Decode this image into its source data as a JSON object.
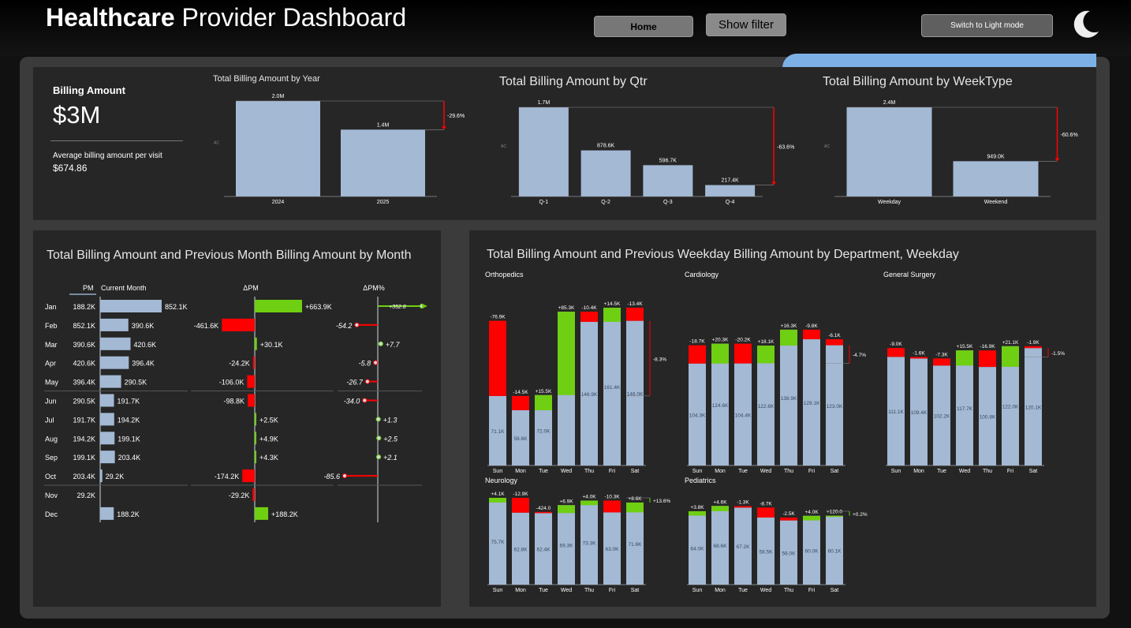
{
  "header": {
    "title_bold": "Healthcare",
    "title_rest": "Provider Dashboard",
    "home_label": "Home",
    "filter_label": "Show filter",
    "light_mode_label": "Switch to Light mode"
  },
  "kpi": {
    "label": "Billing Amount",
    "value": "$3M",
    "sub_label": "Average billing amount per visit",
    "sub_value": "$674.86"
  },
  "colors": {
    "bar": "#a3b9d4",
    "pos": "#6fcf12",
    "neg": "#ff0000"
  },
  "year_chart": {
    "title": "Total Billing Amount by Year",
    "axis_label": "AC",
    "categories": [
      "2024",
      "2025"
    ],
    "values": [
      2.0,
      1.4
    ],
    "labels": [
      "2.0M",
      "1.4M"
    ],
    "variance": "-29.6%"
  },
  "qtr_chart": {
    "title": "Total Billing Amount by Qtr",
    "axis_label": "AC",
    "categories": [
      "Q-1",
      "Q-2",
      "Q-3",
      "Q-4"
    ],
    "values": [
      1.7,
      0.8786,
      0.5967,
      0.2174
    ],
    "labels": [
      "1.7M",
      "878.6K",
      "596.7K",
      "217.4K"
    ],
    "variance": "-63.6%"
  },
  "week_chart": {
    "title": "Total Billing Amount by WeekType",
    "axis_label": "AC",
    "categories": [
      "Weekday",
      "Weekend"
    ],
    "values": [
      2.4,
      0.949
    ],
    "labels": [
      "2.4M",
      "949.0K"
    ],
    "variance": "-60.6%"
  },
  "month_table": {
    "title": "Total Billing Amount and Previous Month Billing Amount by Month",
    "headers": {
      "pm": "PM",
      "cm": "Current Month",
      "dpm": "ΔPM",
      "dpmp": "ΔPM%"
    },
    "rows": [
      {
        "month": "Jan",
        "pm": "188.2K",
        "cm": "852.1K",
        "cmv": 852.1,
        "d": "+663.9K",
        "dv": 663.9,
        "p": "+352.8",
        "pv": 352.8
      },
      {
        "month": "Feb",
        "pm": "852.1K",
        "cm": "390.6K",
        "cmv": 390.6,
        "d": "-461.6K",
        "dv": -461.6,
        "p": "-54.2",
        "pv": -54.2
      },
      {
        "month": "Mar",
        "pm": "390.6K",
        "cm": "420.6K",
        "cmv": 420.6,
        "d": "+30.1K",
        "dv": 30.1,
        "p": "+7.7",
        "pv": 7.7
      },
      {
        "month": "Apr",
        "pm": "420.6K",
        "cm": "396.4K",
        "cmv": 396.4,
        "d": "-24.2K",
        "dv": -24.2,
        "p": "-5.8",
        "pv": -5.8
      },
      {
        "month": "May",
        "pm": "396.4K",
        "cm": "290.5K",
        "cmv": 290.5,
        "d": "-106.0K",
        "dv": -106,
        "p": "-26.7",
        "pv": -26.7
      },
      {
        "month": "Jun",
        "pm": "290.5K",
        "cm": "191.7K",
        "cmv": 191.7,
        "d": "-98.8K",
        "dv": -98.8,
        "p": "-34.0",
        "pv": -34.0
      },
      {
        "month": "Jul",
        "pm": "191.7K",
        "cm": "194.2K",
        "cmv": 194.2,
        "d": "+2.5K",
        "dv": 2.5,
        "p": "+1.3",
        "pv": 1.3
      },
      {
        "month": "Aug",
        "pm": "194.2K",
        "cm": "199.1K",
        "cmv": 199.1,
        "d": "+4.9K",
        "dv": 4.9,
        "p": "+2.5",
        "pv": 2.5
      },
      {
        "month": "Sep",
        "pm": "199.1K",
        "cm": "203.4K",
        "cmv": 203.4,
        "d": "+4.3K",
        "dv": 4.3,
        "p": "+2.1",
        "pv": 2.1
      },
      {
        "month": "Oct",
        "pm": "203.4K",
        "cm": "29.2K",
        "cmv": 29.2,
        "d": "-174.2K",
        "dv": -174.2,
        "p": "-85.6",
        "pv": -85.6
      },
      {
        "month": "Nov",
        "pm": "29.2K",
        "cm": "",
        "cmv": 0,
        "d": "-29.2K",
        "dv": -29.2,
        "p": "",
        "pv": 0
      },
      {
        "month": "Dec",
        "pm": "",
        "cm": "188.2K",
        "cmv": 188.2,
        "d": "+188.2K",
        "dv": 188.2,
        "p": "",
        "pv": 0
      }
    ]
  },
  "dept_chart": {
    "title": "Total Billing Amount and Previous Weekday Billing Amount by Department, Weekday",
    "days": [
      "Sun",
      "Mon",
      "Tue",
      "Wed",
      "Thu",
      "Fri",
      "Sat"
    ],
    "departments": [
      {
        "name": "Orthopedics",
        "values": [
          71.1,
          56.6,
          72.0,
          157.3,
          146.9,
          161.4,
          148.0
        ],
        "value_labels": [
          "71.1K",
          "56.6K",
          "72.0K",
          "157.3K",
          "146.9K",
          "161.4K",
          "148.0K"
        ],
        "delta_labels": [
          "-76.9K",
          "-14.5K",
          "+15.5K",
          "+85.3K",
          "-10.4K",
          "+14.5K",
          "-13.4K"
        ],
        "variance": "-8.3%"
      },
      {
        "name": "Cardiology",
        "values": [
          104.3,
          124.6,
          104.4,
          122.6,
          138.9,
          129.1,
          123.0
        ],
        "value_labels": [
          "104.3K",
          "124.6K",
          "104.4K",
          "122.6K",
          "138.9K",
          "129.1K",
          "123.0K"
        ],
        "delta_labels": [
          "-18.7K",
          "+20.3K",
          "-20.2K",
          "+18.1K",
          "+16.3K",
          "-9.8K",
          "-6.1K"
        ],
        "variance": "-4.7%"
      },
      {
        "name": "General Surgery",
        "values": [
          111.1,
          109.4,
          102.2,
          117.7,
          100.8,
          122.0,
          120.1
        ],
        "value_labels": [
          "111.1K",
          "109.4K",
          "102.2K",
          "117.7K",
          "100.8K",
          "122.0K",
          "120.1K"
        ],
        "delta_labels": [
          "-9.0K",
          "-1.6K",
          "-7.3K",
          "+15.5K",
          "-16.9K",
          "+21.1K",
          "-1.9K"
        ],
        "variance": "-1.5%"
      },
      {
        "name": "Neurology",
        "values": [
          75.7,
          62.8,
          62.4,
          69.3,
          73.3,
          63.0,
          71.6
        ],
        "value_labels": [
          "75.7K",
          "62.8K",
          "62.4K",
          "69.3K",
          "73.3K",
          "63.0K",
          "71.6K"
        ],
        "delta_labels": [
          "+4.1K",
          "-12.9K",
          "-424.0",
          "+6.9K",
          "+4.0K",
          "-10.3K",
          "+8.6K"
        ],
        "variance": "+13.6%"
      },
      {
        "name": "Pediatrics",
        "values": [
          64.0,
          68.6,
          67.2,
          58.5,
          56.0,
          60.0,
          60.1
        ],
        "value_labels": [
          "64.0K",
          "68.6K",
          "67.2K",
          "58.5K",
          "56.0K",
          "60.0K",
          "60.1K"
        ],
        "delta_labels": [
          "+3.8K",
          "+4.6K",
          "-1.3K",
          "-8.7K",
          "-2.5K",
          "+4.0K",
          "+120.0"
        ],
        "variance": "+0.2%"
      }
    ]
  },
  "chart_data": [
    {
      "type": "bar",
      "title": "Total Billing Amount by Year",
      "categories": [
        "2024",
        "2025"
      ],
      "values": [
        2.0,
        1.4
      ],
      "unit": "M"
    },
    {
      "type": "bar",
      "title": "Total Billing Amount by Qtr",
      "categories": [
        "Q-1",
        "Q-2",
        "Q-3",
        "Q-4"
      ],
      "values": [
        1.7,
        0.8786,
        0.5967,
        0.2174
      ],
      "unit": "M"
    },
    {
      "type": "bar",
      "title": "Total Billing Amount by WeekType",
      "categories": [
        "Weekday",
        "Weekend"
      ],
      "values": [
        2.4,
        0.949
      ],
      "unit": "M"
    },
    {
      "type": "table",
      "title": "Total Billing Amount and Previous Month Billing Amount by Month",
      "categories": [
        "Jan",
        "Feb",
        "Mar",
        "Apr",
        "May",
        "Jun",
        "Jul",
        "Aug",
        "Sep",
        "Oct",
        "Nov",
        "Dec"
      ],
      "series": [
        {
          "name": "Current Month",
          "values": [
            852.1,
            390.6,
            420.6,
            396.4,
            290.5,
            191.7,
            194.2,
            199.1,
            203.4,
            29.2,
            0,
            188.2
          ]
        },
        {
          "name": "ΔPM",
          "values": [
            663.9,
            -461.6,
            30.1,
            -24.2,
            -106.0,
            -98.8,
            2.5,
            4.9,
            4.3,
            -174.2,
            -29.2,
            188.2
          ]
        },
        {
          "name": "ΔPM%",
          "values": [
            352.8,
            -54.2,
            7.7,
            -5.8,
            -26.7,
            -34.0,
            1.3,
            2.5,
            2.1,
            -85.6,
            null,
            null
          ]
        }
      ],
      "unit": "K"
    },
    {
      "type": "bar",
      "title": "Total Billing Amount and Previous Weekday Billing Amount by Department, Weekday",
      "categories": [
        "Sun",
        "Mon",
        "Tue",
        "Wed",
        "Thu",
        "Fri",
        "Sat"
      ],
      "series": [
        {
          "name": "Orthopedics",
          "values": [
            71.1,
            56.6,
            72.0,
            157.3,
            146.9,
            161.4,
            148.0
          ]
        },
        {
          "name": "Cardiology",
          "values": [
            104.3,
            124.6,
            104.4,
            122.6,
            138.9,
            129.1,
            123.0
          ]
        },
        {
          "name": "General Surgery",
          "values": [
            111.1,
            109.4,
            102.2,
            117.7,
            100.8,
            122.0,
            120.1
          ]
        },
        {
          "name": "Neurology",
          "values": [
            75.7,
            62.8,
            62.4,
            69.3,
            73.3,
            63.0,
            71.6
          ]
        },
        {
          "name": "Pediatrics",
          "values": [
            64.0,
            68.6,
            67.2,
            58.5,
            56.0,
            60.0,
            60.1
          ]
        }
      ],
      "unit": "K"
    }
  ]
}
